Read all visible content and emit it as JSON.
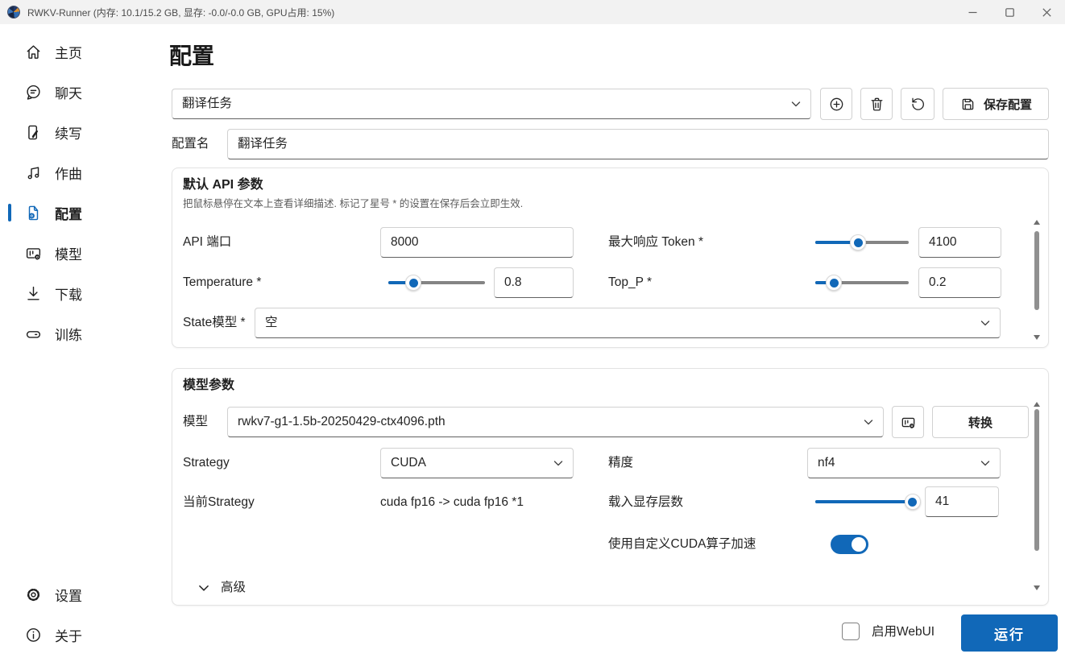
{
  "colors": {
    "accent": "#1168b8"
  },
  "titlebar": {
    "title": "RWKV-Runner (内存: 10.1/15.2 GB, 显存: -0.0/-0.0 GB, GPU占用: 15%)"
  },
  "sidebar": {
    "items": [
      {
        "label": "主页",
        "icon": "home-icon"
      },
      {
        "label": "聊天",
        "icon": "chat-icon"
      },
      {
        "label": "续写",
        "icon": "completion-icon"
      },
      {
        "label": "作曲",
        "icon": "composition-icon"
      },
      {
        "label": "配置",
        "icon": "config-icon",
        "selected": true
      },
      {
        "label": "模型",
        "icon": "models-icon"
      },
      {
        "label": "下载",
        "icon": "download-icon"
      },
      {
        "label": "训练",
        "icon": "train-icon"
      }
    ],
    "bottom_items": [
      {
        "label": "设置",
        "icon": "settings-icon"
      },
      {
        "label": "关于",
        "icon": "about-icon"
      }
    ]
  },
  "page": {
    "title": "配置"
  },
  "config_selector": {
    "value": "翻译任务",
    "save_label": "保存配置"
  },
  "config_name": {
    "label": "配置名",
    "value": "翻译任务"
  },
  "api_section": {
    "title": "默认 API 参数",
    "description": "把鼠标悬停在文本上查看详细描述. 标记了星号 * 的设置在保存后会立即生效.",
    "api_port": {
      "label": "API 端口",
      "value": "8000"
    },
    "max_tokens": {
      "label": "最大响应 Token *",
      "value": "4100",
      "slider_pct": 46
    },
    "temperature": {
      "label": "Temperature *",
      "value": "0.8",
      "slider_pct": 26
    },
    "top_p": {
      "label": "Top_P *",
      "value": "0.2",
      "slider_pct": 20
    },
    "state_model": {
      "label": "State模型 *",
      "value": "空"
    }
  },
  "model_section": {
    "title": "模型参数",
    "model": {
      "label": "模型",
      "value": "rwkv7-g1-1.5b-20250429-ctx4096.pth",
      "convert_label": "转换"
    },
    "strategy": {
      "label": "Strategy",
      "value": "CUDA"
    },
    "precision": {
      "label": "精度",
      "value": "nf4"
    },
    "current_strategy": {
      "label": "当前Strategy",
      "value": "cuda fp16 -> cuda fp16 *1"
    },
    "vram_layers": {
      "label": "载入显存层数",
      "value": "41",
      "slider_pct": 96
    },
    "custom_cuda": {
      "label": "使用自定义CUDA算子加速",
      "enabled": true
    },
    "advanced_label": "高级"
  },
  "footer": {
    "webui_label": "启用WebUI",
    "run_label": "运行",
    "webui_checked": false
  }
}
